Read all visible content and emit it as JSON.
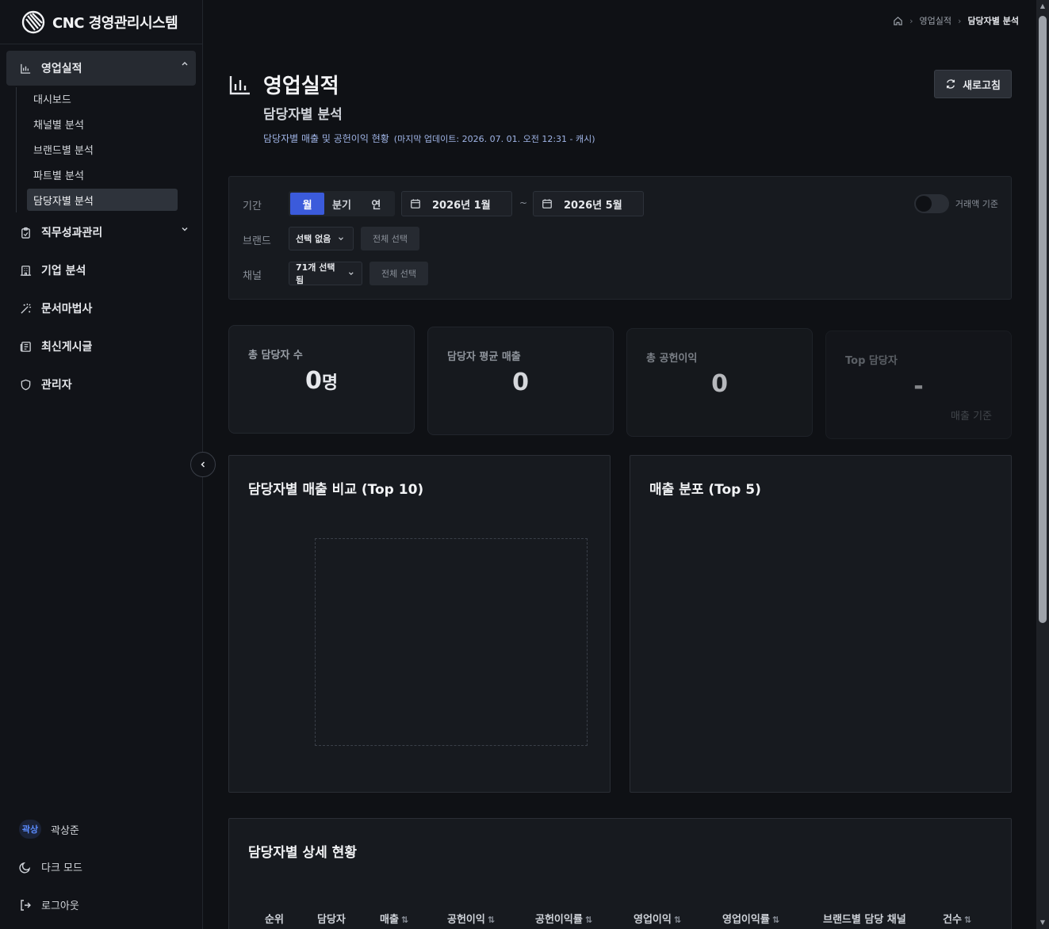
{
  "app": {
    "brand": "CNC 경영관리시스템"
  },
  "sidebar": {
    "active_group": "영업실적",
    "sub_items": [
      "대시보드",
      "채널별 분석",
      "브랜드별 분석",
      "파트별 분석",
      "담당자별 분석"
    ],
    "items": [
      {
        "label": "직무성과관리",
        "icon": "clipboard-icon"
      },
      {
        "label": "기업 분석",
        "icon": "building-icon"
      },
      {
        "label": "문서마법사",
        "icon": "magic-wand-icon"
      },
      {
        "label": "최신게시글",
        "icon": "newspaper-icon"
      },
      {
        "label": "관리자",
        "icon": "shield-icon"
      }
    ],
    "user": {
      "avatar": "곽상",
      "name": "곽상준"
    },
    "dark_mode": "다크 모드",
    "logout": "로그아웃"
  },
  "breadcrumb": [
    "영업실적",
    "담당자별 분석"
  ],
  "page": {
    "title": "영업실적",
    "subtitle": "담당자별 분석",
    "desc": "담당자별 매출 및 공헌이익 현황",
    "updated": "(마지막 업데이트: 2026. 07. 01. 오전 12:31 - 캐시)",
    "refresh": "새로고침"
  },
  "filters": {
    "period_label": "기간",
    "period_tabs": [
      "월",
      "분기",
      "연"
    ],
    "period_active": "월",
    "start": "2026년 1월",
    "tilde": "~",
    "end": "2026년 5월",
    "toggle_label": "거래액 기준",
    "brand_label": "브랜드",
    "brand_value": "선택 없음",
    "brand_select_all": "전체 선택",
    "channel_label": "채널",
    "channel_value": "71개 선택됨",
    "channel_select_all": "전체 선택"
  },
  "kpis": [
    {
      "label": "총 담당자 수",
      "value": "0",
      "unit": "명",
      "sub": ""
    },
    {
      "label": "담당자 평균 매출",
      "value": "0",
      "unit": "",
      "sub": ""
    },
    {
      "label": "총 공헌이익",
      "value": "0",
      "unit": "",
      "sub": ""
    },
    {
      "label": "Top 담당자",
      "value": "-",
      "unit": "",
      "sub": "매출 기준"
    }
  ],
  "charts": {
    "left_title": "담당자별 매출 비교 (Top 10)",
    "right_title": "매출 분포 (Top 5)"
  },
  "table": {
    "title": "담당자별 상세 현황",
    "columns": [
      {
        "label": "순위",
        "sort": ""
      },
      {
        "label": "담당자",
        "sort": ""
      },
      {
        "label": "매출",
        "sort": "⇅"
      },
      {
        "label": "공헌이익",
        "sort": "⇅"
      },
      {
        "label": "공헌이익률",
        "sort": "⇅"
      },
      {
        "label": "영업이익",
        "sort": "⇅"
      },
      {
        "label": "영업이익률",
        "sort": "⇅"
      },
      {
        "label": "브랜드별 담당 채널",
        "sort": ""
      },
      {
        "label": "건수",
        "sort": "⇅"
      }
    ]
  },
  "colors": {
    "accent": "#3b5bdb",
    "background": "#0f1115",
    "panel": "#171a1f"
  }
}
